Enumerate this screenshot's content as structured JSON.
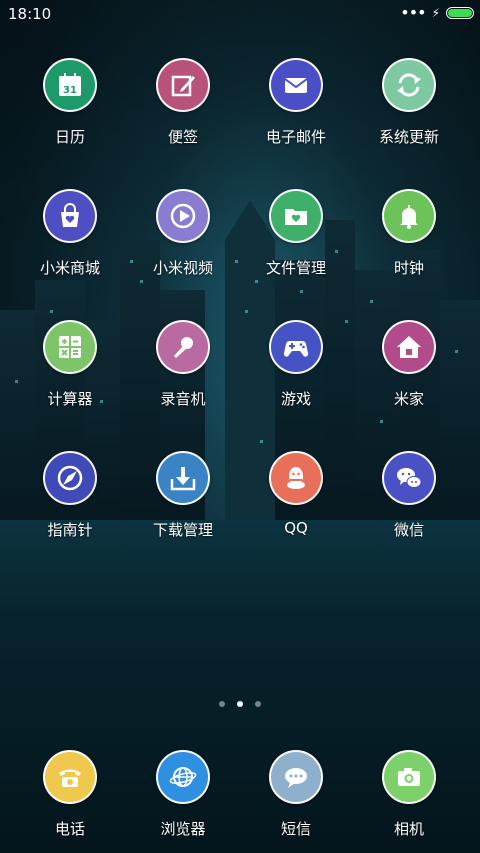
{
  "status_bar": {
    "time": "18:10",
    "battery_level": 1.0,
    "battery_color": "#3ddc4a"
  },
  "apps": [
    {
      "label": "日历",
      "color": "#1e9a6a",
      "icon": "calendar-icon",
      "calendar_day": "31"
    },
    {
      "label": "便签",
      "color": "#b8527a",
      "icon": "note-edit-icon"
    },
    {
      "label": "电子邮件",
      "color": "#4a4fc7",
      "icon": "envelope-icon"
    },
    {
      "label": "系统更新",
      "color": "#7ec9a2",
      "icon": "refresh-arrows-icon"
    },
    {
      "label": "小米商城",
      "color": "#4f4fc4",
      "icon": "shopping-bag-icon"
    },
    {
      "label": "小米视频",
      "color": "#8a7cd0",
      "icon": "play-icon"
    },
    {
      "label": "文件管理",
      "color": "#3fb06a",
      "icon": "folder-icon"
    },
    {
      "label": "时钟",
      "color": "#6cc35a",
      "icon": "bell-icon"
    },
    {
      "label": "计算器",
      "color": "#7ec56a",
      "icon": "calculator-icon"
    },
    {
      "label": "录音机",
      "color": "#b96aa0",
      "icon": "microphone-icon"
    },
    {
      "label": "游戏",
      "color": "#4653c4",
      "icon": "gamepad-icon"
    },
    {
      "label": "米家",
      "color": "#b24b8a",
      "icon": "house-icon"
    },
    {
      "label": "指南针",
      "color": "#4049b8",
      "icon": "compass-icon"
    },
    {
      "label": "下载管理",
      "color": "#3a84c6",
      "icon": "download-icon"
    },
    {
      "label": "QQ",
      "color": "#e8705a",
      "icon": "qq-penguin-icon"
    },
    {
      "label": "微信",
      "color": "#4a51c4",
      "icon": "chat-bubbles-icon"
    }
  ],
  "page_indicator": {
    "pages": 3,
    "current": 2
  },
  "dock": [
    {
      "label": "电话",
      "color": "#f0c84e",
      "icon": "phone-icon"
    },
    {
      "label": "浏览器",
      "color": "#2f8fe0",
      "icon": "globe-icon"
    },
    {
      "label": "短信",
      "color": "#8fb0cc",
      "icon": "message-icon"
    },
    {
      "label": "相机",
      "color": "#7ed16a",
      "icon": "camera-icon"
    }
  ]
}
